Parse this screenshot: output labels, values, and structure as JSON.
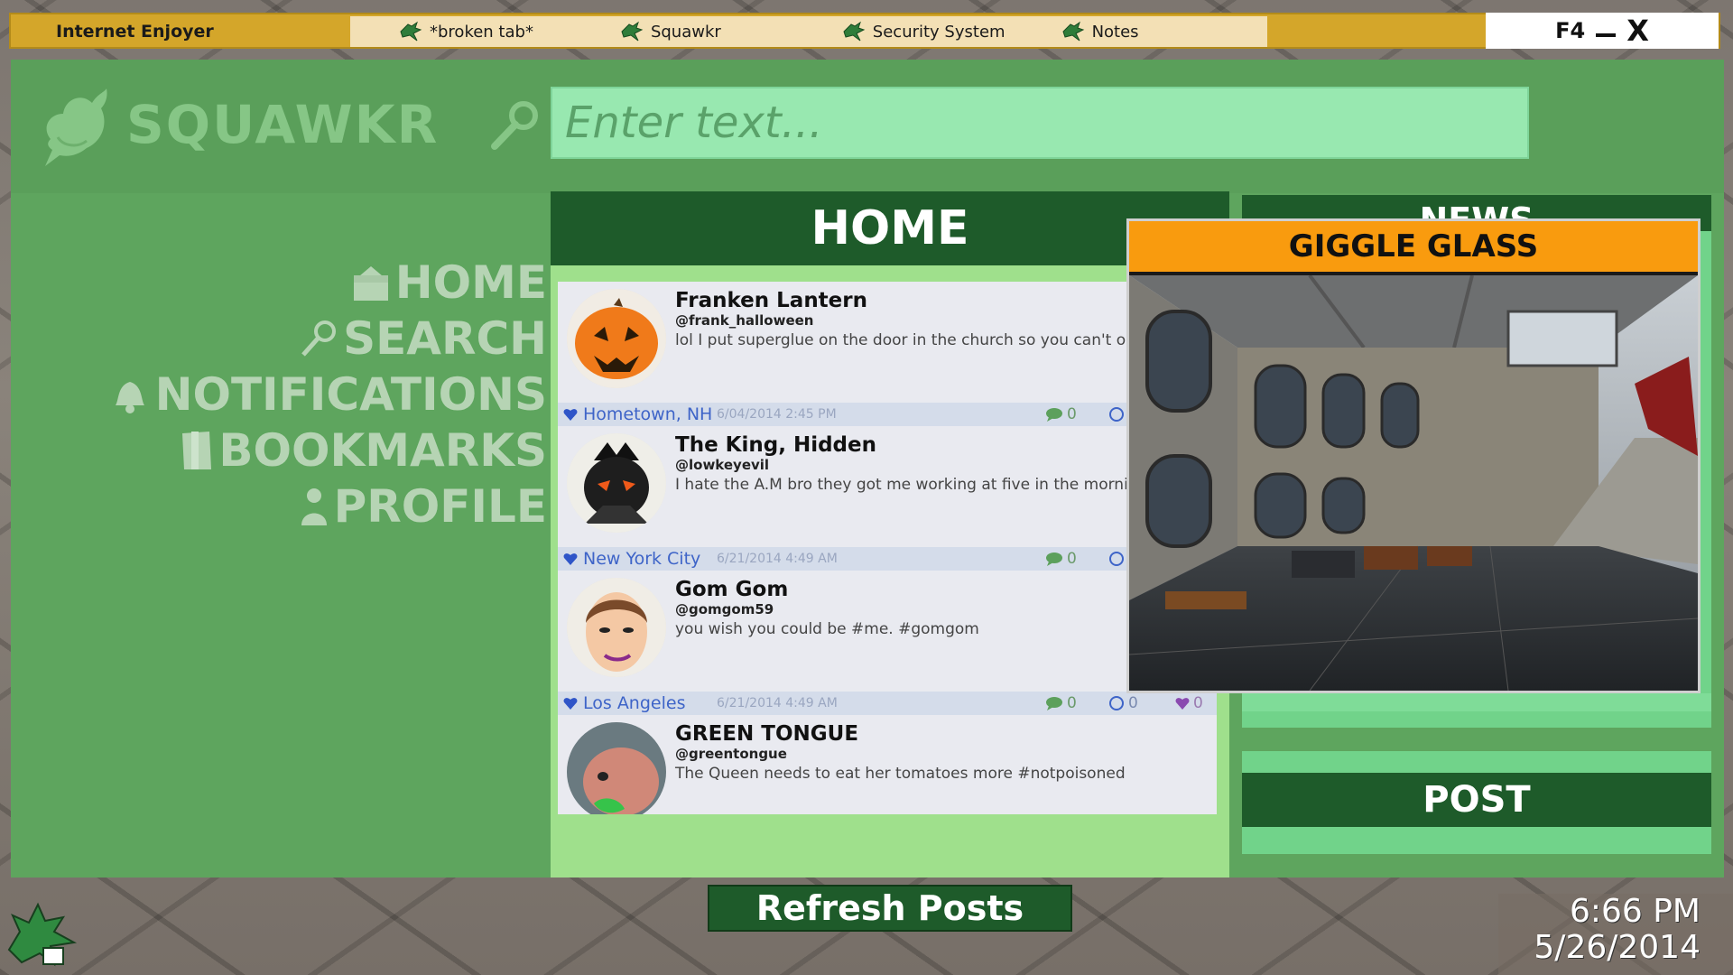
{
  "topbar": {
    "app_title": "Internet Enjoyer",
    "tabs": [
      {
        "label": "*broken tab*",
        "icon": "gator-icon"
      },
      {
        "label": "Squawkr",
        "icon": "gator-icon"
      },
      {
        "label": "Security System",
        "icon": "gator-icon"
      },
      {
        "label": "Notes",
        "icon": "gator-icon"
      }
    ],
    "window_controls": {
      "f4_label": "F4",
      "close_label": "X"
    }
  },
  "header": {
    "logo_text": "SQUAWKR",
    "search_placeholder": "Enter text..."
  },
  "nav": {
    "items": [
      {
        "label": "HOME",
        "icon": "house-icon"
      },
      {
        "label": "SEARCH",
        "icon": "search-icon"
      },
      {
        "label": "NOTIFICATIONS",
        "icon": "bell-icon"
      },
      {
        "label": "BOOKMARKS",
        "icon": "bookmark-icon"
      },
      {
        "label": "PROFILE",
        "icon": "person-icon"
      }
    ]
  },
  "home": {
    "title": "HOME",
    "posts": [
      {
        "name": "Franken Lantern",
        "handle": "@frank_halloween",
        "text": "lol I put superglue on the door in the church so you can't op lmao",
        "location": "Hometown, NH",
        "timestamp": "6/04/2014 2:45 PM",
        "comments": "0"
      },
      {
        "name": "The King, Hidden",
        "handle": "@lowkeyevil",
        "text": "I hate the A.M bro they got me working at five in the mornin",
        "location": "New York City",
        "timestamp": "6/21/2014 4:49 AM",
        "comments": "0"
      },
      {
        "name": "Gom Gom",
        "handle": "@gomgom59",
        "text": "you wish you could be #me. #gomgom",
        "location": "Los Angeles",
        "timestamp": "6/21/2014 4:49 AM",
        "comments": "0",
        "resquawks": "0",
        "likes": "0"
      },
      {
        "name": "GREEN TONGUE",
        "handle": "@greentongue",
        "text": "The Queen needs to eat her tomatoes more #notpoisoned"
      }
    ],
    "refresh_label": "Refresh Posts"
  },
  "news": {
    "title": "NEWS",
    "post_label": "POST"
  },
  "popup": {
    "title": "GIGGLE GLASS"
  },
  "clock": {
    "time": "6:66 PM",
    "date": "5/26/2014"
  },
  "colors": {
    "topbar": "#d4a62a",
    "window_green": "#5ea55e",
    "dark_green": "#1e5b2a",
    "search_bg": "#98e8b0",
    "popup_title": "#f99b0e"
  }
}
